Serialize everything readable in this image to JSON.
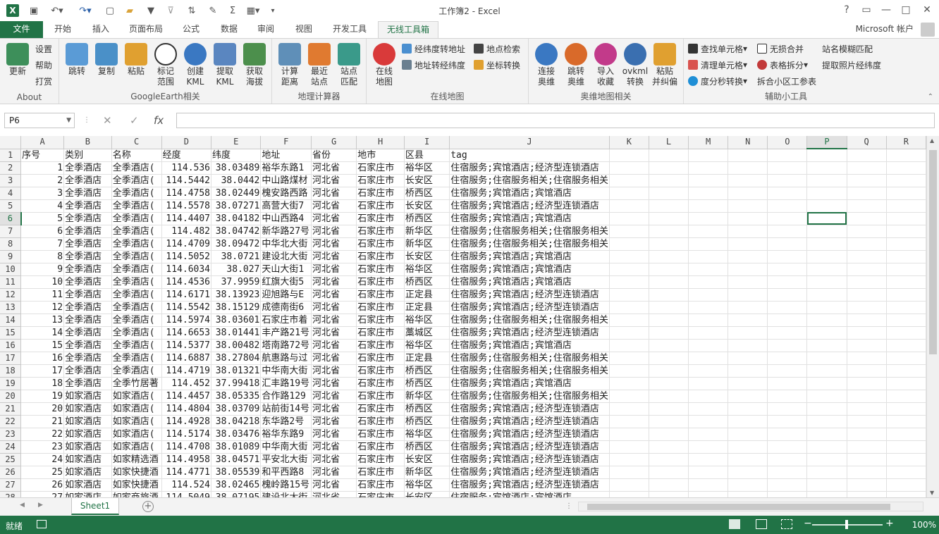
{
  "app": {
    "window_title": "工作簿2 - Excel",
    "logo": "X",
    "account": "Microsoft 帐户"
  },
  "tabs": {
    "file": "文件",
    "items": [
      "开始",
      "插入",
      "页面布局",
      "公式",
      "数据",
      "审阅",
      "视图",
      "开发工具"
    ],
    "active": "无线工具箱"
  },
  "ribbon": {
    "about": {
      "update": "更新",
      "settings": "设置",
      "help": "帮助",
      "donate": "打赏",
      "group": "About"
    },
    "ge": {
      "jump": "跳转",
      "copy": "复制",
      "paste": "粘贴",
      "mark1": "标记",
      "mark2": "范围",
      "create1": "创建",
      "create2": "KML",
      "extract1": "提取",
      "extract2": "KML",
      "elev1": "获取",
      "elev2": "海拔",
      "group": "GoogleEarth相关"
    },
    "geo": {
      "calc1": "计算",
      "calc2": "距离",
      "near1": "最近",
      "near2": "站点",
      "match1": "站点",
      "match2": "匹配",
      "group": "地理计算器"
    },
    "online": {
      "map1": "在线",
      "map2": "地图",
      "geocode": "经纬度转地址",
      "revgeo": "地址转经纬度",
      "search": "地点检索",
      "convert": "坐标转换",
      "group": "在线地图"
    },
    "ovi": {
      "connect1": "连接",
      "connect2": "奥维",
      "jump1": "跳转",
      "jump2": "奥维",
      "import1": "导入",
      "import2": "收藏",
      "ovkml1": "ovkml",
      "ovkml2": "转换",
      "paste1": "粘贴",
      "paste2": "并纠偏",
      "group": "奥维地图相关"
    },
    "tools": {
      "find": "查找单元格",
      "clean": "清理单元格",
      "dms": "度分秒转换",
      "merge": "无损合并",
      "split": "表格拆分",
      "community": "拆合小区工参表",
      "fuzzy": "站名模糊匹配",
      "photo": "提取照片经纬度",
      "group": "辅助小工具"
    }
  },
  "formula": {
    "name_box": "P6",
    "cancel": "✕",
    "enter": "✓",
    "fx": "fx",
    "value": ""
  },
  "columns": [
    "A",
    "B",
    "C",
    "D",
    "E",
    "F",
    "G",
    "H",
    "I",
    "J",
    "K",
    "L",
    "M",
    "N",
    "O",
    "P",
    "Q",
    "R"
  ],
  "selected_col": "P",
  "selected_row": 6,
  "header_row": [
    "序号",
    "类别",
    "名称",
    "经度",
    "纬度",
    "地址",
    "省份",
    "地市",
    "区县",
    "tag"
  ],
  "rows": [
    [
      "1",
      "全季酒店",
      "全季酒店(",
      "114.536",
      "38.03489",
      "裕华东路1",
      "河北省",
      "石家庄市",
      "裕华区",
      "住宿服务;宾馆酒店;经济型连锁酒店"
    ],
    [
      "2",
      "全季酒店",
      "全季酒店(",
      "114.5442",
      "38.0442",
      "中山路煤材",
      "河北省",
      "石家庄市",
      "长安区",
      "住宿服务;住宿服务相关;住宿服务相关"
    ],
    [
      "3",
      "全季酒店",
      "全季酒店(",
      "114.4758",
      "38.02449",
      "槐安路西路",
      "河北省",
      "石家庄市",
      "桥西区",
      "住宿服务;宾馆酒店;宾馆酒店"
    ],
    [
      "4",
      "全季酒店",
      "全季酒店(",
      "114.5578",
      "38.07271",
      "高营大街7",
      "河北省",
      "石家庄市",
      "长安区",
      "住宿服务;宾馆酒店;经济型连锁酒店"
    ],
    [
      "5",
      "全季酒店",
      "全季酒店(",
      "114.4407",
      "38.04182",
      "中山西路4",
      "河北省",
      "石家庄市",
      "桥西区",
      "住宿服务;宾馆酒店;宾馆酒店"
    ],
    [
      "6",
      "全季酒店",
      "全季酒店(",
      "114.482",
      "38.04742",
      "新华路27号",
      "河北省",
      "石家庄市",
      "新华区",
      "住宿服务;住宿服务相关;住宿服务相关"
    ],
    [
      "7",
      "全季酒店",
      "全季酒店(",
      "114.4709",
      "38.09472",
      "中华北大街",
      "河北省",
      "石家庄市",
      "新华区",
      "住宿服务;住宿服务相关;住宿服务相关"
    ],
    [
      "8",
      "全季酒店",
      "全季酒店(",
      "114.5052",
      "38.0721",
      "建设北大街",
      "河北省",
      "石家庄市",
      "长安区",
      "住宿服务;宾馆酒店;宾馆酒店"
    ],
    [
      "9",
      "全季酒店",
      "全季酒店(",
      "114.6034",
      "38.027",
      "天山大街1",
      "河北省",
      "石家庄市",
      "裕华区",
      "住宿服务;宾馆酒店;宾馆酒店"
    ],
    [
      "10",
      "全季酒店",
      "全季酒店(",
      "114.4536",
      "37.9959",
      "红旗大街5",
      "河北省",
      "石家庄市",
      "桥西区",
      "住宿服务;宾馆酒店;宾馆酒店"
    ],
    [
      "11",
      "全季酒店",
      "全季酒店(",
      "114.6171",
      "38.13923",
      "迎旭路与E",
      "河北省",
      "石家庄市",
      "正定县",
      "住宿服务;宾馆酒店;经济型连锁酒店"
    ],
    [
      "12",
      "全季酒店",
      "全季酒店(",
      "114.5542",
      "38.15129",
      "成德南街6",
      "河北省",
      "石家庄市",
      "正定县",
      "住宿服务;宾馆酒店;经济型连锁酒店"
    ],
    [
      "13",
      "全季酒店",
      "全季酒店(",
      "114.5974",
      "38.03601",
      "石家庄市着",
      "河北省",
      "石家庄市",
      "裕华区",
      "住宿服务;住宿服务相关;住宿服务相关"
    ],
    [
      "14",
      "全季酒店",
      "全季酒店(",
      "114.6653",
      "38.01441",
      "丰产路21号",
      "河北省",
      "石家庄市",
      "藁城区",
      "住宿服务;宾馆酒店;经济型连锁酒店"
    ],
    [
      "15",
      "全季酒店",
      "全季酒店(",
      "114.5377",
      "38.00482",
      "塔南路72号",
      "河北省",
      "石家庄市",
      "裕华区",
      "住宿服务;宾馆酒店;宾馆酒店"
    ],
    [
      "16",
      "全季酒店",
      "全季酒店(",
      "114.6887",
      "38.27804",
      "航惠路与过",
      "河北省",
      "石家庄市",
      "正定县",
      "住宿服务;住宿服务相关;住宿服务相关"
    ],
    [
      "17",
      "全季酒店",
      "全季酒店(",
      "114.4719",
      "38.01321",
      "中华南大街",
      "河北省",
      "石家庄市",
      "桥西区",
      "住宿服务;住宿服务相关;住宿服务相关"
    ],
    [
      "18",
      "全季酒店",
      "全季竹居著",
      "114.452",
      "37.99418",
      "汇丰路19号",
      "河北省",
      "石家庄市",
      "桥西区",
      "住宿服务;宾馆酒店;宾馆酒店"
    ],
    [
      "19",
      "如家酒店",
      "如家酒店(",
      "114.4457",
      "38.05335",
      "合作路129",
      "河北省",
      "石家庄市",
      "新华区",
      "住宿服务;住宿服务相关;住宿服务相关"
    ],
    [
      "20",
      "如家酒店",
      "如家酒店(",
      "114.4804",
      "38.03709",
      "站前街14号",
      "河北省",
      "石家庄市",
      "桥西区",
      "住宿服务;宾馆酒店;经济型连锁酒店"
    ],
    [
      "21",
      "如家酒店",
      "如家酒店(",
      "114.4928",
      "38.04218",
      "东华路2号",
      "河北省",
      "石家庄市",
      "桥西区",
      "住宿服务;宾馆酒店;经济型连锁酒店"
    ],
    [
      "22",
      "如家酒店",
      "如家酒店(",
      "114.5174",
      "38.03476",
      "裕华东路9",
      "河北省",
      "石家庄市",
      "裕华区",
      "住宿服务;宾馆酒店;经济型连锁酒店"
    ],
    [
      "23",
      "如家酒店",
      "如家酒店(",
      "114.4708",
      "38.01089",
      "中华南大街",
      "河北省",
      "石家庄市",
      "桥西区",
      "住宿服务;宾馆酒店;经济型连锁酒店"
    ],
    [
      "24",
      "如家酒店",
      "如家精选酒",
      "114.4958",
      "38.04571",
      "平安北大街",
      "河北省",
      "石家庄市",
      "长安区",
      "住宿服务;宾馆酒店;经济型连锁酒店"
    ],
    [
      "25",
      "如家酒店",
      "如家快捷酒",
      "114.4771",
      "38.05539",
      "和平西路8",
      "河北省",
      "石家庄市",
      "新华区",
      "住宿服务;宾馆酒店;经济型连锁酒店"
    ],
    [
      "26",
      "如家酒店",
      "如家快捷酒",
      "114.524",
      "38.02465",
      "槐岭路15号",
      "河北省",
      "石家庄市",
      "裕华区",
      "住宿服务;宾馆酒店;经济型连锁酒店"
    ],
    [
      "27",
      "如家酒店",
      "如家商旅酒",
      "114.5049",
      "38.07195",
      "建设北大街",
      "河北省",
      "石家庄市",
      "长安区",
      "住宿服务;宾馆酒店;宾馆酒店"
    ]
  ],
  "sheet_tabs": [
    "Sheet1"
  ],
  "status": {
    "ready": "就绪",
    "zoom": "100%",
    "zoom_level": 1.0
  },
  "colors": {
    "accent": "#217346"
  }
}
